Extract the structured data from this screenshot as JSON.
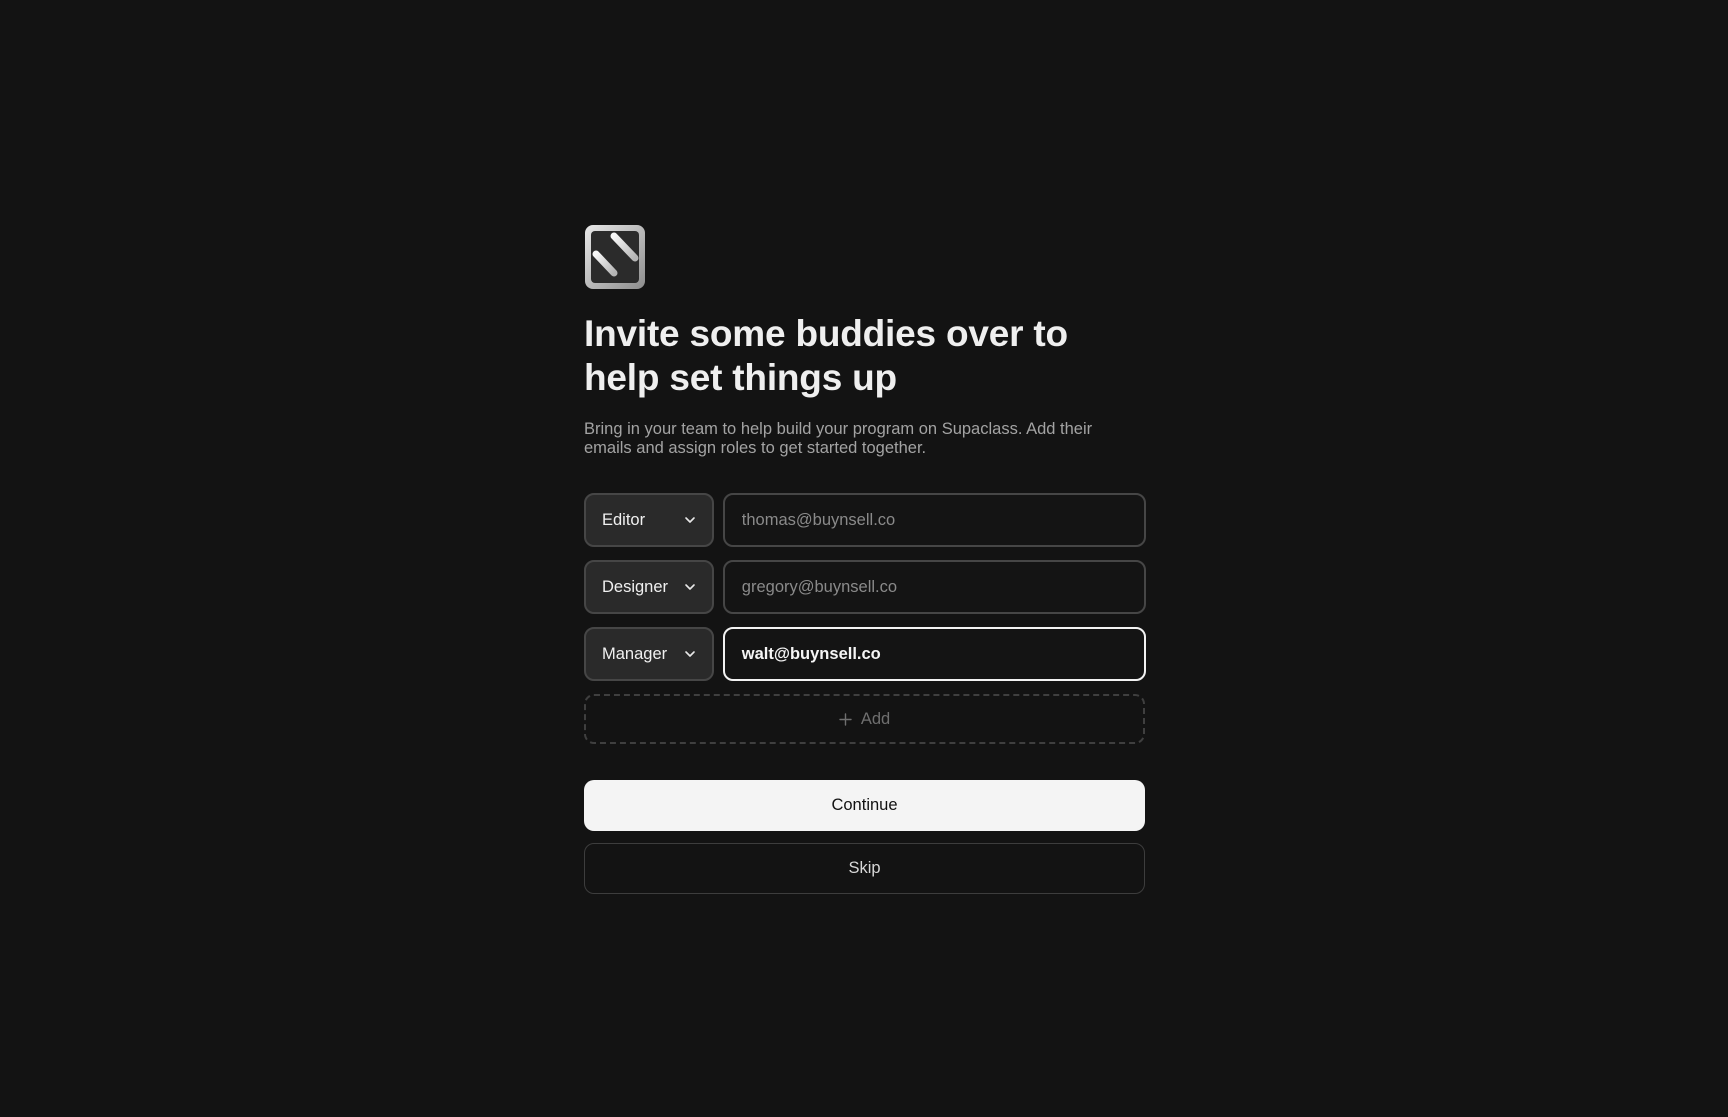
{
  "brand": {
    "logo_icon": "supaclass-logo-icon"
  },
  "heading": {
    "title": "Invite some buddies over to help set things up",
    "subtitle": "Bring in your team to help build your program on Supaclass. Add their emails and assign roles to get started together."
  },
  "invites": [
    {
      "role": "Editor",
      "email": "thomas@buynsell.co",
      "active": false
    },
    {
      "role": "Designer",
      "email": "gregory@buynsell.co",
      "active": false
    },
    {
      "role": "Manager",
      "email": "walt@buynsell.co",
      "active": true
    }
  ],
  "add": {
    "label": "Add",
    "icon": "plus-icon"
  },
  "actions": {
    "continue_label": "Continue",
    "skip_label": "Skip"
  },
  "colors": {
    "background": "#131313",
    "primary_button": "#f4f4f4",
    "field_border": "#464646",
    "active_border": "#f2f2f2"
  }
}
